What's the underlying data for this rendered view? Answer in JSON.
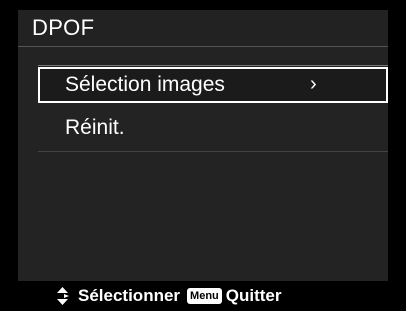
{
  "title": "DPOF",
  "menu": {
    "items": [
      {
        "label": "Sélection images",
        "arrow": "›",
        "selected": true
      },
      {
        "label": "Réinit.",
        "selected": false
      }
    ]
  },
  "footer": {
    "nav_icon": "up-down-arrows-icon",
    "select_label": "Sélectionner",
    "menu_badge": "Menu",
    "quit_label": "Quitter"
  }
}
